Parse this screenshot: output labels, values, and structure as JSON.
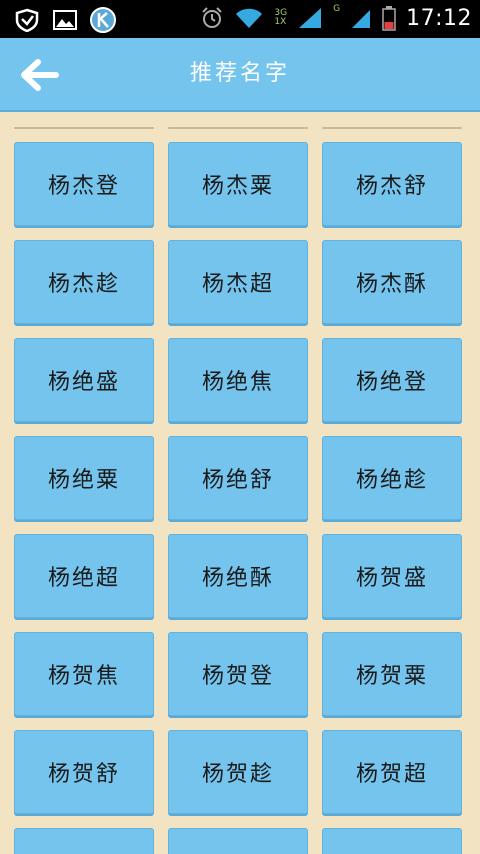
{
  "status_bar": {
    "time": "17:12",
    "network_3g": "3G",
    "network_1x": "1X",
    "network_g": "G",
    "icons": [
      "shield-icon",
      "gallery-icon",
      "k-app-icon",
      "alarm-icon",
      "wifi-icon",
      "signal-icon",
      "battery-icon"
    ]
  },
  "app_bar": {
    "title": "推荐名字",
    "back_icon": "arrow-left-icon"
  },
  "names": [
    [
      "杨杰登",
      "杨杰粟",
      "杨杰舒"
    ],
    [
      "杨杰趁",
      "杨杰超",
      "杨杰酥"
    ],
    [
      "杨绝盛",
      "杨绝焦",
      "杨绝登"
    ],
    [
      "杨绝粟",
      "杨绝舒",
      "杨绝趁"
    ],
    [
      "杨绝超",
      "杨绝酥",
      "杨贺盛"
    ],
    [
      "杨贺焦",
      "杨贺登",
      "杨贺粟"
    ],
    [
      "杨贺舒",
      "杨贺趁",
      "杨贺超"
    ]
  ],
  "colors": {
    "accent": "#74c4ee",
    "background": "#f2e3c3",
    "status_bar": "#000000"
  }
}
